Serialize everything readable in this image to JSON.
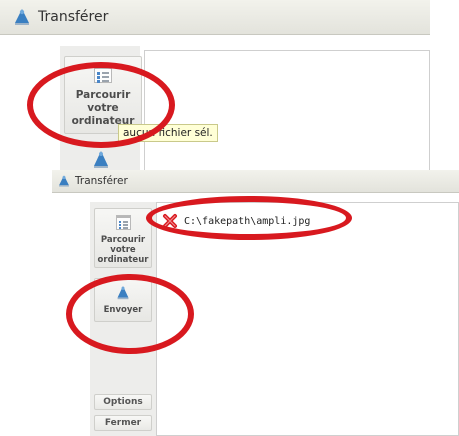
{
  "back_window": {
    "title": "Transférer",
    "browse_button": "Parcourir votre ordinateur",
    "tooltip": "aucun fichier sél."
  },
  "front_window": {
    "title": "Transférer",
    "browse_button": "Parcourir votre ordinateur",
    "send_button": "Envoyer",
    "options_button": "Options",
    "close_button": "Fermer",
    "files": [
      {
        "path": "C:\\fakepath\\ampli.jpg",
        "status_icon": "remove-x-icon"
      }
    ]
  },
  "colors": {
    "annotation_ring": "#d8191f",
    "icon_blue": "#4a86c8",
    "remove_red": "#d8191f"
  }
}
